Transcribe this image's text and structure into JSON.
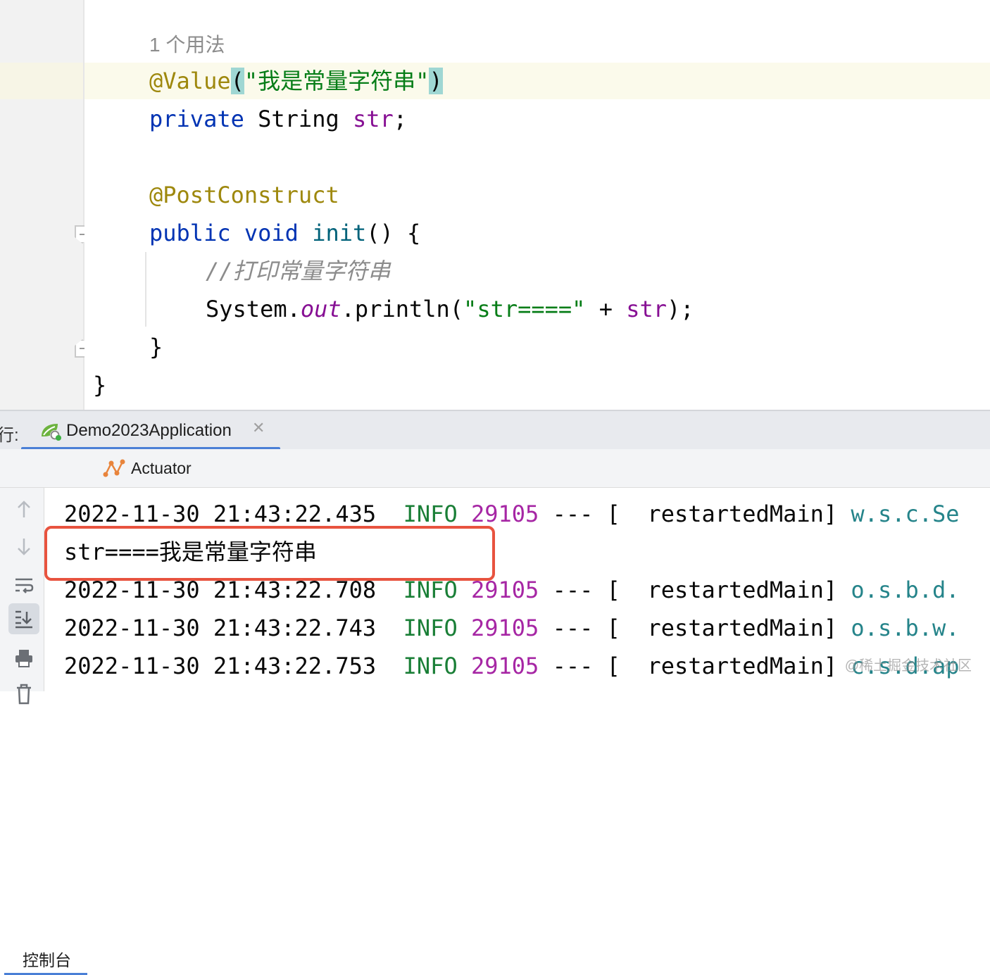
{
  "editor": {
    "usage_hint": "1 个用法",
    "lines": {
      "value_annotation": "@Value",
      "value_open": "(",
      "value_string": "\"我是常量字符串\"",
      "value_close": ")",
      "field_modifier": "private",
      "field_type": "String",
      "field_name": "str",
      "field_semicolon": ";",
      "postconstruct": "@PostConstruct",
      "method_public": "public",
      "method_void": "void",
      "method_name": "init",
      "method_rest": "() {",
      "comment": "//打印常量字符串",
      "print_system": "System.",
      "print_out": "out",
      "print_call": ".println(",
      "print_string": "\"str====\"",
      "print_plus": " + ",
      "print_field": "str",
      "print_end": ");",
      "method_close": "}",
      "class_close": "}"
    }
  },
  "run_panel": {
    "prefix": "行:",
    "tab_label": "Demo2023Application",
    "tab_icon": "spring-boot-run-icon",
    "sub_tabs": [
      "控制台",
      "Actuator"
    ],
    "toolbar_icons": [
      "up-arrow-icon",
      "down-arrow-icon",
      "soft-wrap-icon",
      "scroll-to-end-icon",
      "print-icon",
      "clear-icon"
    ]
  },
  "console": {
    "lines": [
      {
        "timestamp": "2022-11-30 21:43:22.435",
        "level": "INFO",
        "pid": "29105",
        "sep": "---",
        "thread": "[  restartedMain]",
        "logger": "w.s.c.Se"
      },
      {
        "text": "str====我是常量字符串"
      },
      {
        "timestamp": "2022-11-30 21:43:22.708",
        "level": "INFO",
        "pid": "29105",
        "sep": "---",
        "thread": "[  restartedMain]",
        "logger": "o.s.b.d."
      },
      {
        "timestamp": "2022-11-30 21:43:22.743",
        "level": "INFO",
        "pid": "29105",
        "sep": "---",
        "thread": "[  restartedMain]",
        "logger": "o.s.b.w."
      },
      {
        "timestamp": "2022-11-30 21:43:22.753",
        "level": "INFO",
        "pid": "29105",
        "sep": "---",
        "thread": "[  restartedMain]",
        "logger": "c.s.d.ap"
      }
    ]
  },
  "watermark": "@稀土掘金技术社区",
  "colors": {
    "keyword": "#0033b3",
    "annotation": "#9e880d",
    "string": "#067d17",
    "field": "#871094",
    "log_level": "#1a7f37",
    "pid": "#a626a4",
    "logger": "#25848a",
    "highlight_box": "#e8533f",
    "tab_underline": "#4a7fd6"
  }
}
